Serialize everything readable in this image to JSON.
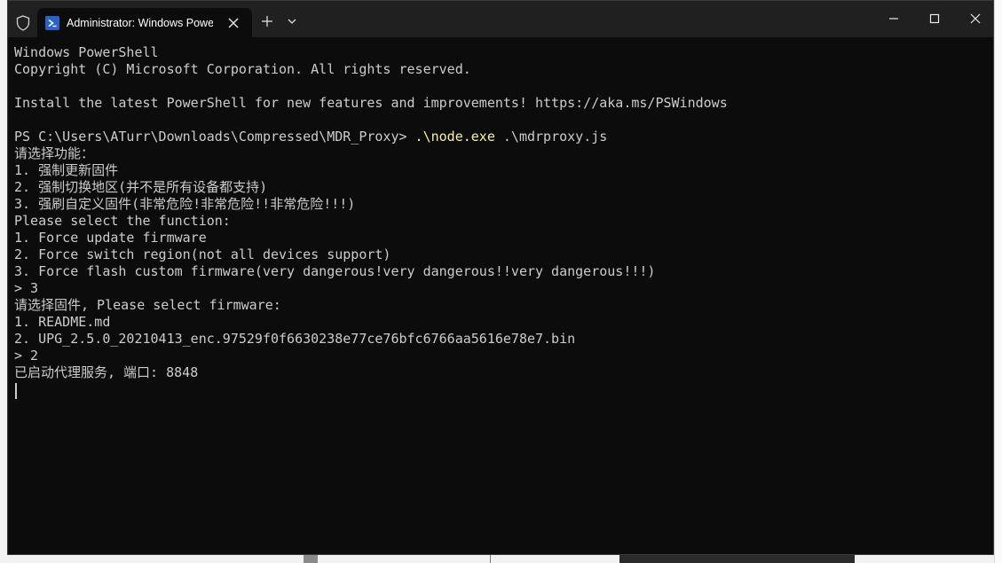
{
  "window": {
    "tab_title": "Administrator: Windows PowerShell",
    "tab_icon": "powershell-icon",
    "controls": [
      "minimize-icon",
      "maximize-icon",
      "close-icon"
    ]
  },
  "colors": {
    "terminal_bg": "#0c0c0c",
    "titlebar_bg": "#202020",
    "text": "#cccccc",
    "command_highlight": "#f9f1a5"
  },
  "console": {
    "banner_title": "Windows PowerShell",
    "copyright": "Copyright (C) Microsoft Corporation. All rights reserved.",
    "blank_1": "",
    "install_hint": "Install the latest PowerShell for new features and improvements! https://aka.ms/PSWindows",
    "blank_2": "",
    "prompt_path": "PS C:\\Users\\ATurr\\Downloads\\Compressed\\MDR_Proxy> ",
    "prompt_exe": ".\\node.exe",
    "prompt_args": " .\\mdrproxy.js",
    "select_function_cn": "请选择功能：",
    "option1_cn": "1. 强制更新固件",
    "option2_cn": "2. 强制切换地区(并不是所有设备都支持)",
    "option3_cn": "3. 强刷自定义固件(非常危险!非常危险!!非常危险!!!)",
    "select_function_en": "Please select the function:",
    "option1_en": "1. Force update firmware",
    "option2_en": "2. Force switch region(not all devices support)",
    "option3_en": "3. Force flash custom firmware(very dangerous!very dangerous!!very dangerous!!!)",
    "input_1": "> 3",
    "select_firmware": "请选择固件, Please select firmware:",
    "firmware_1": "1. README.md",
    "firmware_2": "2. UPG_2.5.0_20210413_enc.97529f0f6630238e77ce76bfc6766aa5616e78e7.bin",
    "input_2": "> 2",
    "proxy_started": "已启动代理服务, 端口: 8848"
  }
}
